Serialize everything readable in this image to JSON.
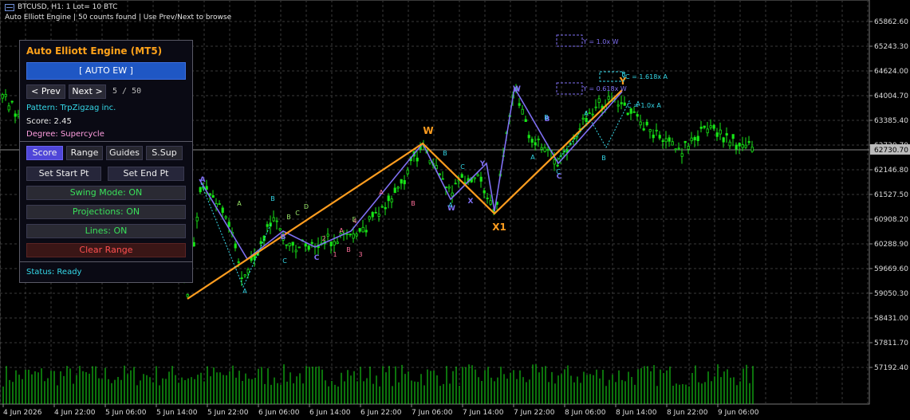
{
  "window": {
    "symbol": "BTCUSD, H1:  1 Lot= 10 BTC",
    "subtitle": "Auto Elliott Engine | 50 counts found | Use Prev/Next to browse"
  },
  "panel": {
    "title": "Auto Elliott Engine (MT5)",
    "auto_button": "[ AUTO EW ]",
    "prev_label": "< Prev",
    "next_label": "Next >",
    "counter": "5  /  50",
    "pattern": "Pattern: TrpZigzag inc.",
    "score": "Score:   2.45",
    "degree": "Degree:  Supercycle",
    "tabs": [
      "Score",
      "Range",
      "Guides",
      "S.Sup"
    ],
    "set_start": "Set Start Pt",
    "set_end": "Set End Pt",
    "swing_mode": "Swing Mode: ON",
    "projections": "Projections: ON",
    "lines": "Lines: ON",
    "clear_range": "Clear Range",
    "status": "Status: Ready"
  },
  "colors": {
    "background": "#000000",
    "grid": "#3a3a3a",
    "candle": "#17e617",
    "orange": "#ff9d1f",
    "purple": "#7f6ff2",
    "cyan": "#35d8e8",
    "pink": "#ff6f9a",
    "green_button_text": "#3ae05a",
    "red_button_text": "#ff5050"
  },
  "price_axis": [
    "65862.60",
    "65243.30",
    "64624.00",
    "64004.70",
    "63385.40",
    "62730.70",
    "62146.80",
    "61527.50",
    "60908.20",
    "60288.90",
    "59669.60",
    "59050.30",
    "58431.00",
    "57811.70",
    "57192.40"
  ],
  "current_price": "62730.70",
  "time_axis": [
    "4 Jun 2026",
    "4 Jun 22:00",
    "5 Jun 06:00",
    "5 Jun 14:00",
    "5 Jun 22:00",
    "6 Jun 06:00",
    "6 Jun 14:00",
    "6 Jun 22:00",
    "7 Jun 06:00",
    "7 Jun 14:00",
    "7 Jun 22:00",
    "8 Jun 06:00",
    "8 Jun 14:00",
    "8 Jun 22:00",
    "9 Jun 06:00"
  ],
  "wave_labels": {
    "major": [
      "W",
      "X1",
      "Y"
    ],
    "minor_purple": [
      "A",
      "B",
      "C",
      "W",
      "X",
      "Y",
      "A",
      "B",
      "C",
      "W"
    ],
    "minor_cyan": [
      "A",
      "B",
      "C",
      "A",
      "B",
      "C",
      "A",
      "B",
      "C",
      "A",
      "B",
      "A",
      "B"
    ],
    "minor_pink": [
      "A",
      "B",
      "A",
      "B",
      "1",
      "2",
      "3",
      "4"
    ],
    "minor_green": [
      "A",
      "B",
      "C",
      "D",
      "E"
    ]
  },
  "projections": [
    "Y = 1.0x W",
    "Y = 0.618x W",
    "C = 1.618x A",
    "C = 1.0x A"
  ]
}
